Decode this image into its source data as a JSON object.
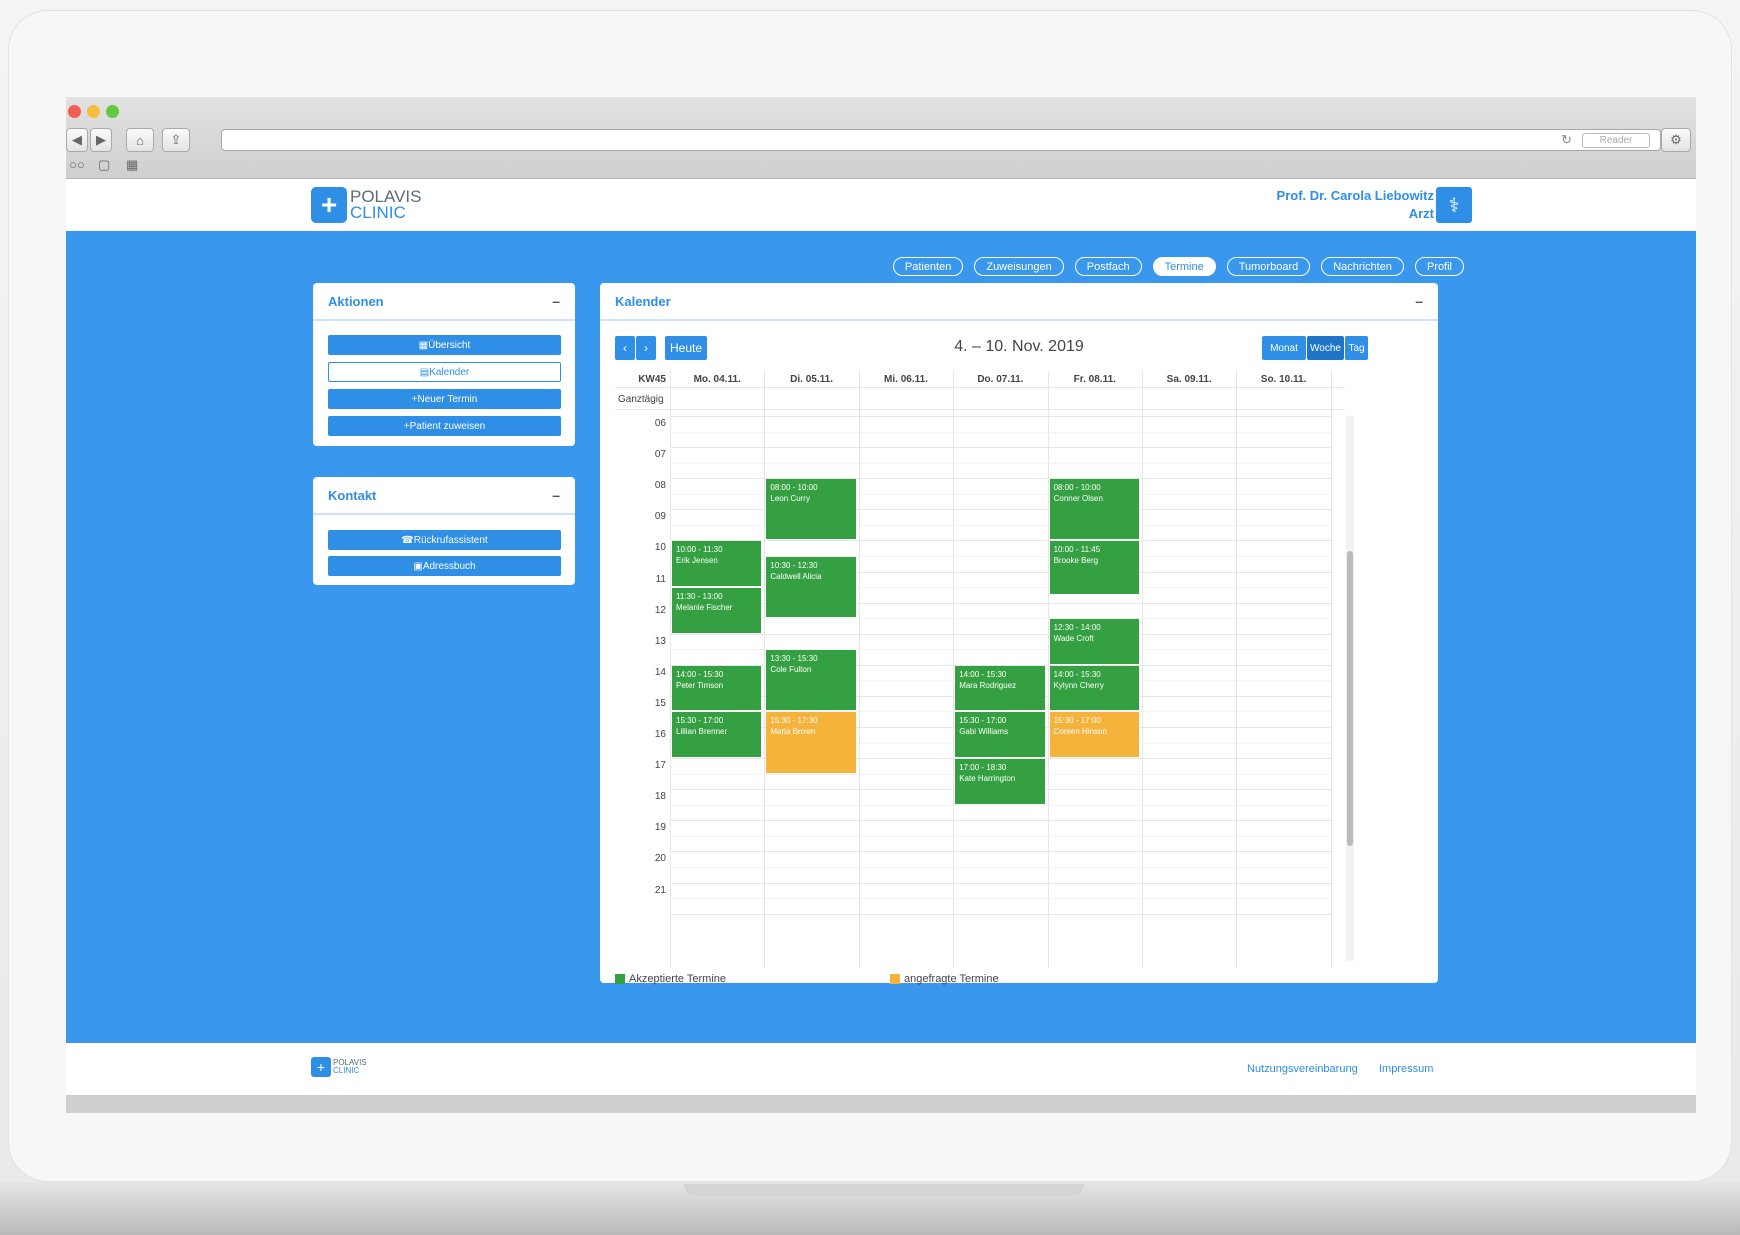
{
  "browser": {
    "reader_label": "Reader",
    "reload_icon": "reload-icon"
  },
  "brand": {
    "name_line1": "POLAVIS",
    "name_line2": "CLINIC",
    "color": "#2f8ee6"
  },
  "user": {
    "name": "Prof. Dr. Carola Liebowitz",
    "role": "Arzt"
  },
  "nav": {
    "items": [
      {
        "label": "Patienten",
        "active": false
      },
      {
        "label": "Zuweisungen",
        "active": false
      },
      {
        "label": "Postfach",
        "active": false
      },
      {
        "label": "Termine",
        "active": true
      },
      {
        "label": "Tumorboard",
        "active": false
      },
      {
        "label": "Nachrichten",
        "active": false
      },
      {
        "label": "Profil",
        "active": false
      }
    ]
  },
  "actions_panel": {
    "title": "Aktionen",
    "buttons": [
      {
        "label": "Übersicht",
        "style": "filled"
      },
      {
        "label": "Kalender",
        "style": "outline"
      },
      {
        "label": "Neuer Termin",
        "style": "filled"
      },
      {
        "label": "Patient zuweisen",
        "style": "filled"
      }
    ]
  },
  "contact_panel": {
    "title": "Kontakt",
    "buttons": [
      {
        "label": "Rückrufassistent"
      },
      {
        "label": "Adressbuch"
      }
    ]
  },
  "calendar": {
    "title": "Kalender",
    "today_label": "Heute",
    "range": "4. – 10. Nov. 2019",
    "views": [
      "Monat",
      "Woche",
      "Tag"
    ],
    "kw_label": "KW45",
    "allday_label": "Ganztägig",
    "days": [
      "Mo. 04.11.",
      "Di. 05.11.",
      "Mi. 06.11.",
      "Do. 07.11.",
      "Fr. 08.11.",
      "Sa. 09.11.",
      "So. 10.11."
    ],
    "hours": [
      "06",
      "07",
      "08",
      "09",
      "10",
      "11",
      "12",
      "13",
      "14",
      "15",
      "16",
      "17",
      "18",
      "19",
      "20",
      "21"
    ],
    "events": [
      {
        "day": 1,
        "start": 8.0,
        "end": 10.0,
        "time": "08:00 - 10:00",
        "name": "Leon Curry",
        "status": "accepted"
      },
      {
        "day": 1,
        "start": 10.5,
        "end": 12.5,
        "time": "10:30 - 12:30",
        "name": "Caldwell Alicia",
        "status": "accepted"
      },
      {
        "day": 1,
        "start": 13.5,
        "end": 15.5,
        "time": "13:30 - 15:30",
        "name": "Cole Fulton",
        "status": "accepted"
      },
      {
        "day": 1,
        "start": 15.5,
        "end": 17.5,
        "time": "15:30 - 17:30",
        "name": "Marla Brown",
        "status": "requested"
      },
      {
        "day": 0,
        "start": 10.0,
        "end": 11.5,
        "time": "10:00 - 11:30",
        "name": "Erik Jensen",
        "status": "accepted"
      },
      {
        "day": 0,
        "start": 11.5,
        "end": 13.0,
        "time": "11:30 - 13:00",
        "name": "Melanie Fischer",
        "status": "accepted"
      },
      {
        "day": 0,
        "start": 14.0,
        "end": 15.5,
        "time": "14:00 - 15:30",
        "name": "Peter Timson",
        "status": "accepted"
      },
      {
        "day": 0,
        "start": 15.5,
        "end": 17.0,
        "time": "15:30 - 17:00",
        "name": "Lillian Brenner",
        "status": "accepted"
      },
      {
        "day": 3,
        "start": 14.0,
        "end": 15.5,
        "time": "14:00 - 15:30",
        "name": "Mara Rodriguez",
        "status": "accepted"
      },
      {
        "day": 3,
        "start": 15.5,
        "end": 17.0,
        "time": "15:30 - 17:00",
        "name": "Gabi Williams",
        "status": "accepted"
      },
      {
        "day": 3,
        "start": 17.0,
        "end": 18.5,
        "time": "17:00 - 18:30",
        "name": "Kate Harrington",
        "status": "accepted"
      },
      {
        "day": 4,
        "start": 8.0,
        "end": 10.0,
        "time": "08:00 - 10:00",
        "name": "Conner Olsen",
        "status": "accepted"
      },
      {
        "day": 4,
        "start": 10.0,
        "end": 11.75,
        "time": "10:00 - 11:45",
        "name": "Brooke Berg",
        "status": "accepted"
      },
      {
        "day": 4,
        "start": 12.5,
        "end": 14.0,
        "time": "12:30 - 14:00",
        "name": "Wade Croft",
        "status": "accepted"
      },
      {
        "day": 4,
        "start": 14.0,
        "end": 15.5,
        "time": "14:00 - 15:30",
        "name": "Kylynn Cherry",
        "status": "accepted"
      },
      {
        "day": 4,
        "start": 15.5,
        "end": 17.0,
        "time": "15:30 - 17:00",
        "name": "Coreen Hinson",
        "status": "requested"
      }
    ],
    "legend": [
      {
        "label": "Akzeptierte Termine",
        "color": "#35a042"
      },
      {
        "label": "angefragte Termine",
        "color": "#f6b33b"
      }
    ]
  },
  "footer": {
    "links": [
      "Nutzungsvereinbarung",
      "Impressum"
    ]
  }
}
